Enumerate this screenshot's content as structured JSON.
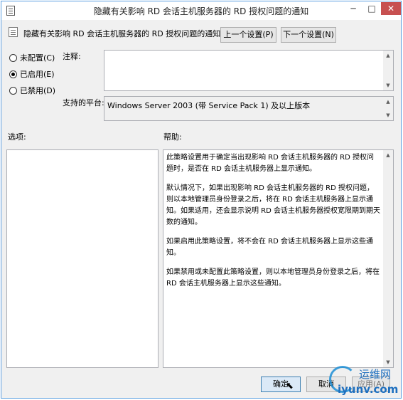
{
  "window": {
    "title": "隐藏有关影响 RD 会话主机服务器的 RD 授权问题的通知",
    "minimize_glyph": "─",
    "maximize_glyph": "□",
    "close_glyph": "✕"
  },
  "header": {
    "setting_title": "隐藏有关影响 RD 会话主机服务器的 RD 授权问题的通知",
    "prev_button": "上一个设置(P)",
    "next_button": "下一个设置(N)"
  },
  "state": {
    "options": [
      {
        "label": "未配置(C)",
        "checked": false
      },
      {
        "label": "已启用(E)",
        "checked": true
      },
      {
        "label": "已禁用(D)",
        "checked": false
      }
    ]
  },
  "comment": {
    "label": "注释:",
    "value": ""
  },
  "supported": {
    "label": "支持的平台:",
    "value": "Windows Server 2003 (带 Service Pack 1) 及以上版本"
  },
  "options_panel": {
    "label": "选项:"
  },
  "help_panel": {
    "label": "帮助:",
    "paragraphs": [
      "此策略设置用于确定当出现影响 RD 会话主机服务器的 RD 授权问题时，是否在 RD 会话主机服务器上显示通知。",
      "默认情况下，如果出现影响 RD 会话主机服务器的 RD 授权问题，则以本地管理员身份登录之后，将在 RD 会话主机服务器上显示通知。如果适用，还会显示说明 RD 会话主机服务器授权宽限期到期天数的通知。",
      "如果启用此策略设置，将不会在 RD 会话主机服务器上显示这些通知。",
      "如果禁用或未配置此策略设置，则以本地管理员身份登录之后，将在 RD 会话主机服务器上显示这些通知。"
    ]
  },
  "footer": {
    "ok": "确定",
    "cancel": "取消",
    "apply": "应用(A)"
  },
  "watermark": {
    "cn": "运维网",
    "url": "iyunv.com"
  }
}
